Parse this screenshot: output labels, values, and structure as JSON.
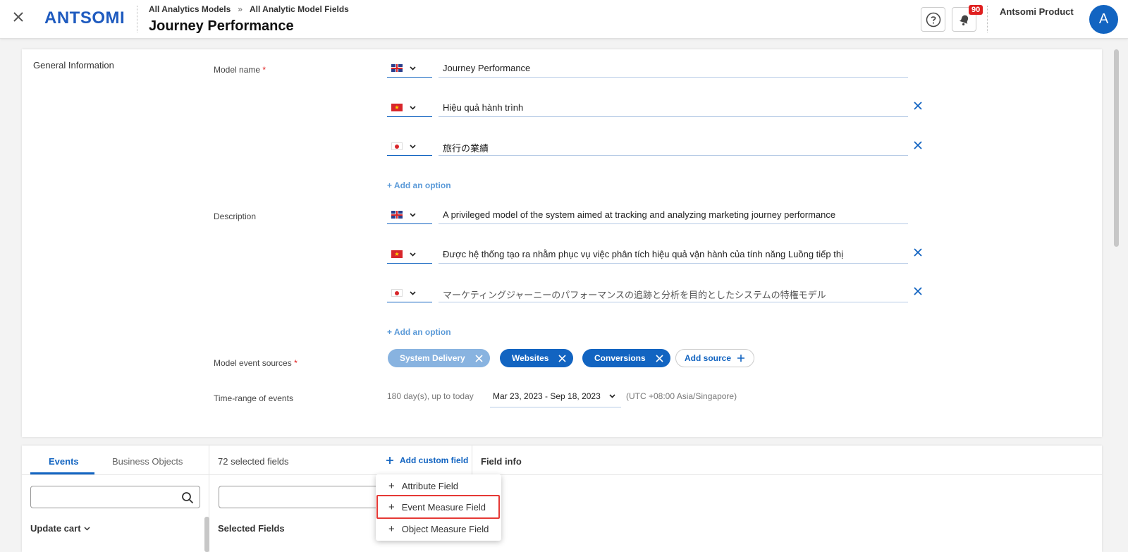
{
  "header": {
    "breadcrumb": [
      "All Analytics Models",
      "All Analytic Model Fields"
    ],
    "breadcrumb_sep": "»",
    "title": "Journey Performance",
    "logo": "ANTSOMI",
    "notification_count": "90",
    "user_name": "Antsomi Product",
    "avatar_letter": "A"
  },
  "general": {
    "section_title": "General Information",
    "model_name_label": "Model name",
    "description_label": "Description",
    "event_sources_label": "Model event sources",
    "time_range_label": "Time-range of events",
    "required_mark": "*",
    "model_names": [
      "Journey Performance",
      "Hiệu quả hành trình",
      "旅行の業績"
    ],
    "descriptions": [
      "A privileged model of the system aimed at tracking and analyzing marketing journey performance",
      "Được hệ thống tạo ra nhằm phục vụ việc phân tích hiệu quả vận hành của tính năng Luồng tiếp thị",
      "マーケティングジャーニーのパフォーマンスの追跡と分析を目的としたシステムの特権モデル"
    ],
    "add_option_label": "+ Add an option",
    "sources": [
      "System Delivery",
      "Websites",
      "Conversions"
    ],
    "add_source_label": "Add source",
    "time_info": "180 day(s), up to today",
    "date_range": "Mar 23, 2023 - Sep 18, 2023",
    "timezone": "(UTC +08:00 Asia/Singapore)"
  },
  "bottom": {
    "tabs": [
      "Events",
      "Business Objects"
    ],
    "selected_count": "72 selected fields",
    "add_custom_label": "Add custom field",
    "field_info_label": "Field info",
    "group_title": "Update cart",
    "selected_fields_label": "Selected Fields"
  },
  "dropdown": {
    "items": [
      "Attribute Field",
      "Event Measure Field",
      "Object Measure Field"
    ],
    "highlighted_index": 1
  },
  "colors": {
    "primary": "#1264c1",
    "chip_light": "#88b3e0",
    "badge": "#e02020",
    "highlight": "#e53935"
  }
}
